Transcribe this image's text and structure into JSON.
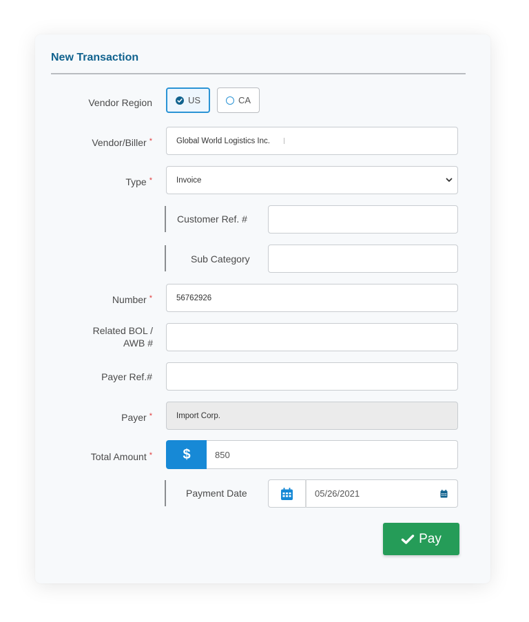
{
  "form": {
    "title": "New Transaction",
    "vendor_region": {
      "label": "Vendor Region",
      "options": [
        {
          "label": "US",
          "selected": true
        },
        {
          "label": "CA",
          "selected": false
        }
      ]
    },
    "vendor_biller": {
      "label": "Vendor/Biller",
      "required": "*",
      "value": "Global World Logistics Inc."
    },
    "type": {
      "label": "Type",
      "required": "*",
      "value": "Invoice"
    },
    "customer_ref": {
      "label": "Customer Ref. #",
      "value": ""
    },
    "sub_category": {
      "label": "Sub Category",
      "value": ""
    },
    "number": {
      "label": "Number",
      "required": "*",
      "value": "56762926"
    },
    "related_bol": {
      "label_line1": "Related BOL /",
      "label_line2": "AWB #",
      "value": ""
    },
    "payer_ref": {
      "label": "Payer Ref.#",
      "value": ""
    },
    "payer": {
      "label": "Payer",
      "required": "*",
      "value": "Import Corp."
    },
    "total_amount": {
      "label": "Total Amount",
      "required": "*",
      "currency_symbol": "$",
      "value": "850"
    },
    "payment_date": {
      "label": "Payment Date",
      "value": "05/26/2021"
    },
    "submit": {
      "label": "Pay",
      "icon": "check-icon"
    }
  },
  "colors": {
    "title": "#10628e",
    "accent": "#1789d6",
    "required": "#e03a3a",
    "pay_button": "#259c58"
  }
}
